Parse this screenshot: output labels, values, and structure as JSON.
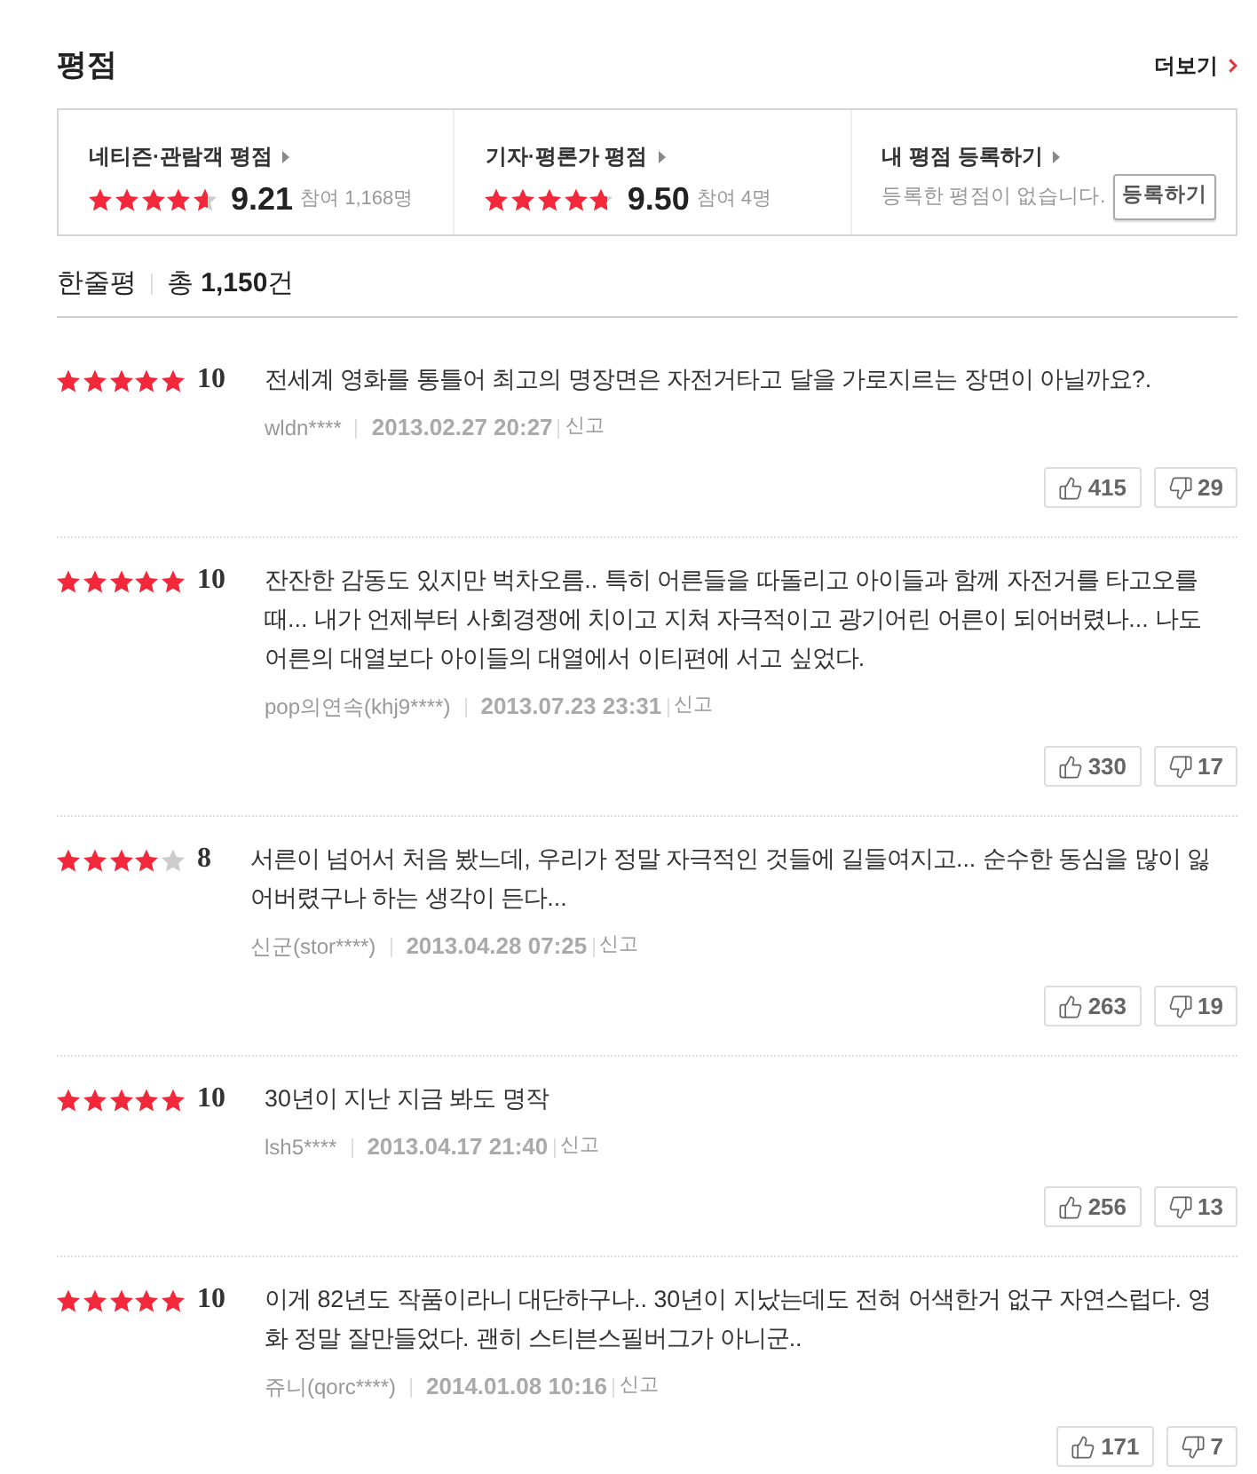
{
  "section": {
    "title": "평점",
    "more_link": "더보기"
  },
  "rating_summary": [
    {
      "kind": "score",
      "label": "네티즌·관람객 평점",
      "stars": 4.6,
      "score": "9.21",
      "participants": "참여 1,168명"
    },
    {
      "kind": "score",
      "label": "기자·평론가 평점",
      "stars": 4.75,
      "score": "9.50",
      "participants": "참여 4명"
    },
    {
      "kind": "register",
      "label": "내 평점 등록하기",
      "message": "등록한 평점이 없습니다.",
      "button": "등록하기"
    }
  ],
  "reviews_header": {
    "title": "한줄평",
    "total": "총 **1,150**건"
  },
  "reviews": [
    {
      "stars": 5,
      "score": "10",
      "text": "전세계 영화를 통틀어 최고의 명장면은 자전거타고 달을 가로지르는 장면이 아닐까요?.",
      "user": "wldn****",
      "date": "2013.02.27 20:27",
      "report": "신고",
      "likes": "415",
      "dislikes": "29"
    },
    {
      "stars": 5,
      "score": "10",
      "text": "잔잔한 감동도 있지만 벅차오름.. 특히 어른들을 따돌리고 아이들과 함께 자전거를 타고오를때... 내가 언제부터 사회경쟁에 치이고 지쳐 자극적이고 광기어린 어른이 되어버렸나... 나도 어른의 대열보다 아이들의 대열에서 이티편에 서고 싶었다.",
      "user": "pop의연속(khj9****)",
      "date": "2013.07.23 23:31",
      "report": "신고",
      "likes": "330",
      "dislikes": "17"
    },
    {
      "stars": 4,
      "score": "8",
      "text": "서른이 넘어서 처음 봤느데, 우리가 정말 자극적인 것들에 길들여지고... 순수한 동심을 많이 잃어버렸구나 하는 생각이 든다...",
      "user": "신군(stor****)",
      "date": "2013.04.28 07:25",
      "report": "신고",
      "likes": "263",
      "dislikes": "19"
    },
    {
      "stars": 5,
      "score": "10",
      "text": "30년이 지난 지금 봐도 명작",
      "user": "lsh5****",
      "date": "2013.04.17 21:40",
      "report": "신고",
      "likes": "256",
      "dislikes": "13"
    },
    {
      "stars": 5,
      "score": "10",
      "text": "이게 82년도 작품이라니 대단하구나.. 30년이 지났는데도 전혀 어색한거 없구 자연스럽다. 영화 정말 잘만들었다. 괜히 스티븐스필버그가 아니군..",
      "user": "쥬니(qorc****)",
      "date": "2014.01.08 10:16",
      "report": "신고",
      "likes": "171",
      "dislikes": "7"
    }
  ]
}
